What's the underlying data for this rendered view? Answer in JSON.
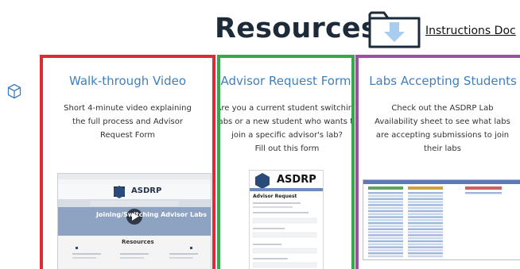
{
  "header": {
    "title": "Resources",
    "instructions_link": "Instructions Doc"
  },
  "icons": {
    "folder": "folder-download-icon",
    "cube": "cube-icon",
    "play": "play-icon"
  },
  "colors": {
    "red_card": "#de2a35",
    "green_card": "#35a84e",
    "purple_card": "#9b4fa3",
    "card_title": "#3f7fbf",
    "heading": "#1d2a3a"
  },
  "cards": [
    {
      "title": "Walk-through Video",
      "description": "Short 4-minute video explaining the full process and Advisor Request Form",
      "thumbnail": {
        "brand": "ASDRP",
        "banner": "Joining/Switching Advisor Labs",
        "section": "Resources"
      }
    },
    {
      "title": "Advisor Request Form",
      "description_lines": [
        "Are you  a current student switching labs or a new student who wants to join a specific advisor's lab?",
        "Fill out this form"
      ],
      "thumbnail": {
        "brand": "ASDRP",
        "form_heading": "Advisor Request"
      }
    },
    {
      "title": "Labs Accepting Students",
      "description": "Check out the ASDRP Lab Availability sheet to see what labs are accepting submissions to join their labs"
    }
  ]
}
